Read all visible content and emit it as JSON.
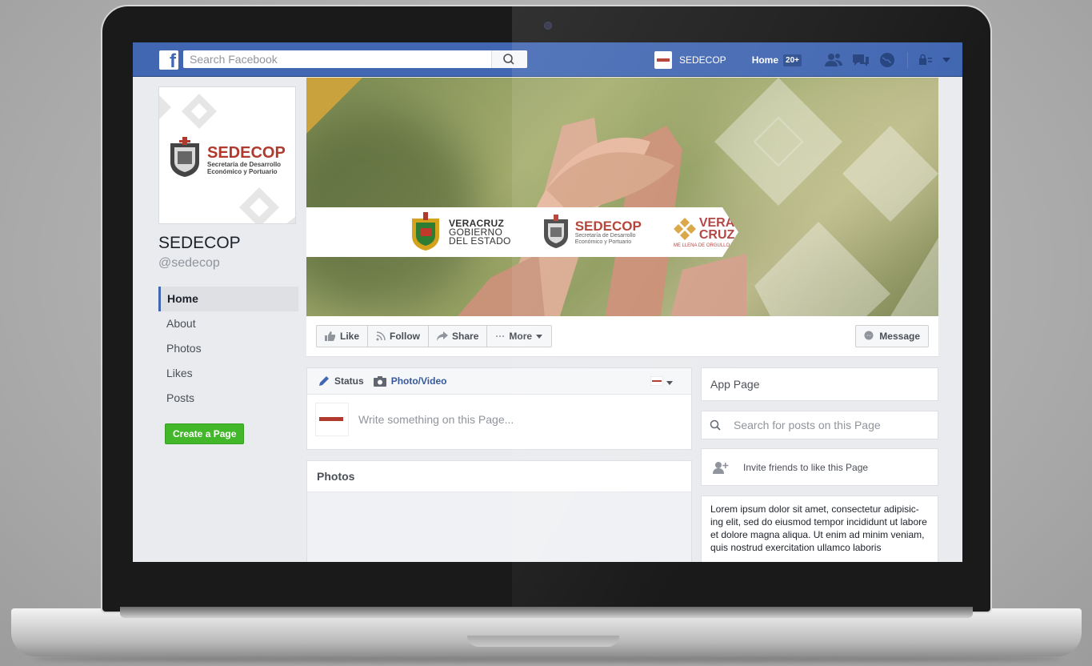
{
  "topbar": {
    "brand_icon": "facebook-logo",
    "search_placeholder": "Search Facebook",
    "page_shortcut": "SEDECOP",
    "home_label": "Home",
    "home_badge": "20+"
  },
  "sidebar": {
    "page_name": "SEDECOP",
    "handle": "@sedecop",
    "logo_title": "SEDECOP",
    "logo_subtitle_1": "Secretaría de Desarrollo",
    "logo_subtitle_2": "Económico y Portuario",
    "nav": [
      {
        "label": "Home",
        "active": true
      },
      {
        "label": "About"
      },
      {
        "label": "Photos"
      },
      {
        "label": "Likes"
      },
      {
        "label": "Posts"
      }
    ],
    "create_page": "Create a Page"
  },
  "cover": {
    "ver_line1": "VERACRUZ",
    "ver_line2": "GOBIERNO",
    "ver_line3": "DEL ESTADO",
    "sed_title": "SEDECOP",
    "sed_sub1": "Secretaría de Desarrollo",
    "sed_sub2": "Económico y Portuario",
    "vera_line1": "VERA",
    "vera_line2": "CRUZ",
    "vera_tag": "ME LLENA DE ORGULLO"
  },
  "actions": {
    "like": "Like",
    "follow": "Follow",
    "share": "Share",
    "more": "More",
    "message": "Message"
  },
  "composer": {
    "status_tab": "Status",
    "photo_tab": "Photo/Video",
    "placeholder": "Write something on this Page..."
  },
  "photos": {
    "title": "Photos"
  },
  "right": {
    "app_page": "App Page",
    "search_placeholder": "Search for posts on this Page",
    "invite": "Invite friends to like this Page",
    "about_text": "Lorem ipsum dolor sit amet, consectetur adipisic-ing elit, sed do eiusmod tempor incididunt ut labore et dolore magna aliqua. Ut enim ad minim veniam, quis nostrud exercitation ullamco laboris"
  }
}
